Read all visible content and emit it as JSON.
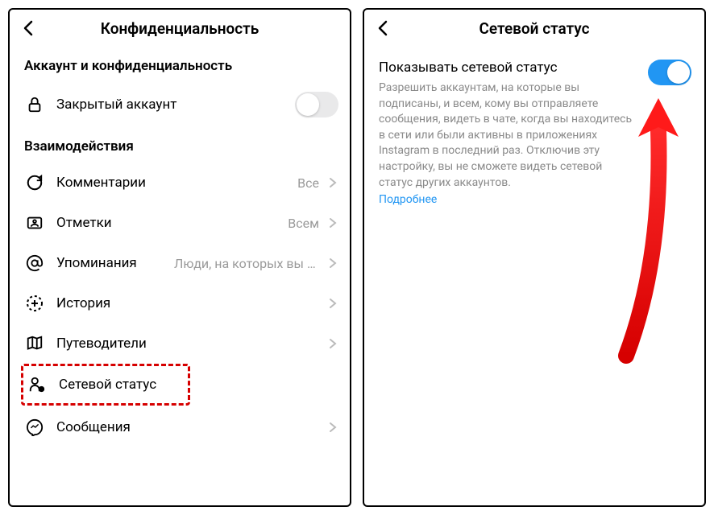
{
  "left": {
    "title": "Конфиденциальность",
    "section1": "Аккаунт и конфиденциальность",
    "private_account": "Закрытый аккаунт",
    "section2": "Взаимодействия",
    "rows": {
      "comments": {
        "label": "Комментарии",
        "value": "Все"
      },
      "tags": {
        "label": "Отметки",
        "value": "Всем"
      },
      "mentions": {
        "label": "Упоминания",
        "value": "Люди, на которых вы п..."
      },
      "story": {
        "label": "История"
      },
      "guides": {
        "label": "Путеводители"
      },
      "activity": {
        "label": "Сетевой статус"
      },
      "messages": {
        "label": "Сообщения"
      }
    }
  },
  "right": {
    "title": "Сетевой статус",
    "setting_title": "Показывать сетевой статус",
    "setting_desc": "Разрешить аккаунтам, на которые вы подписаны, и всем, кому вы отправляете сообщения, видеть в чате, когда вы находитесь в сети или были активны в приложениях Instagram в последний раз. Отключив эту настройку, вы не сможете видеть сетевой статус других аккаунтов.",
    "learn_more": "Подробнее"
  }
}
